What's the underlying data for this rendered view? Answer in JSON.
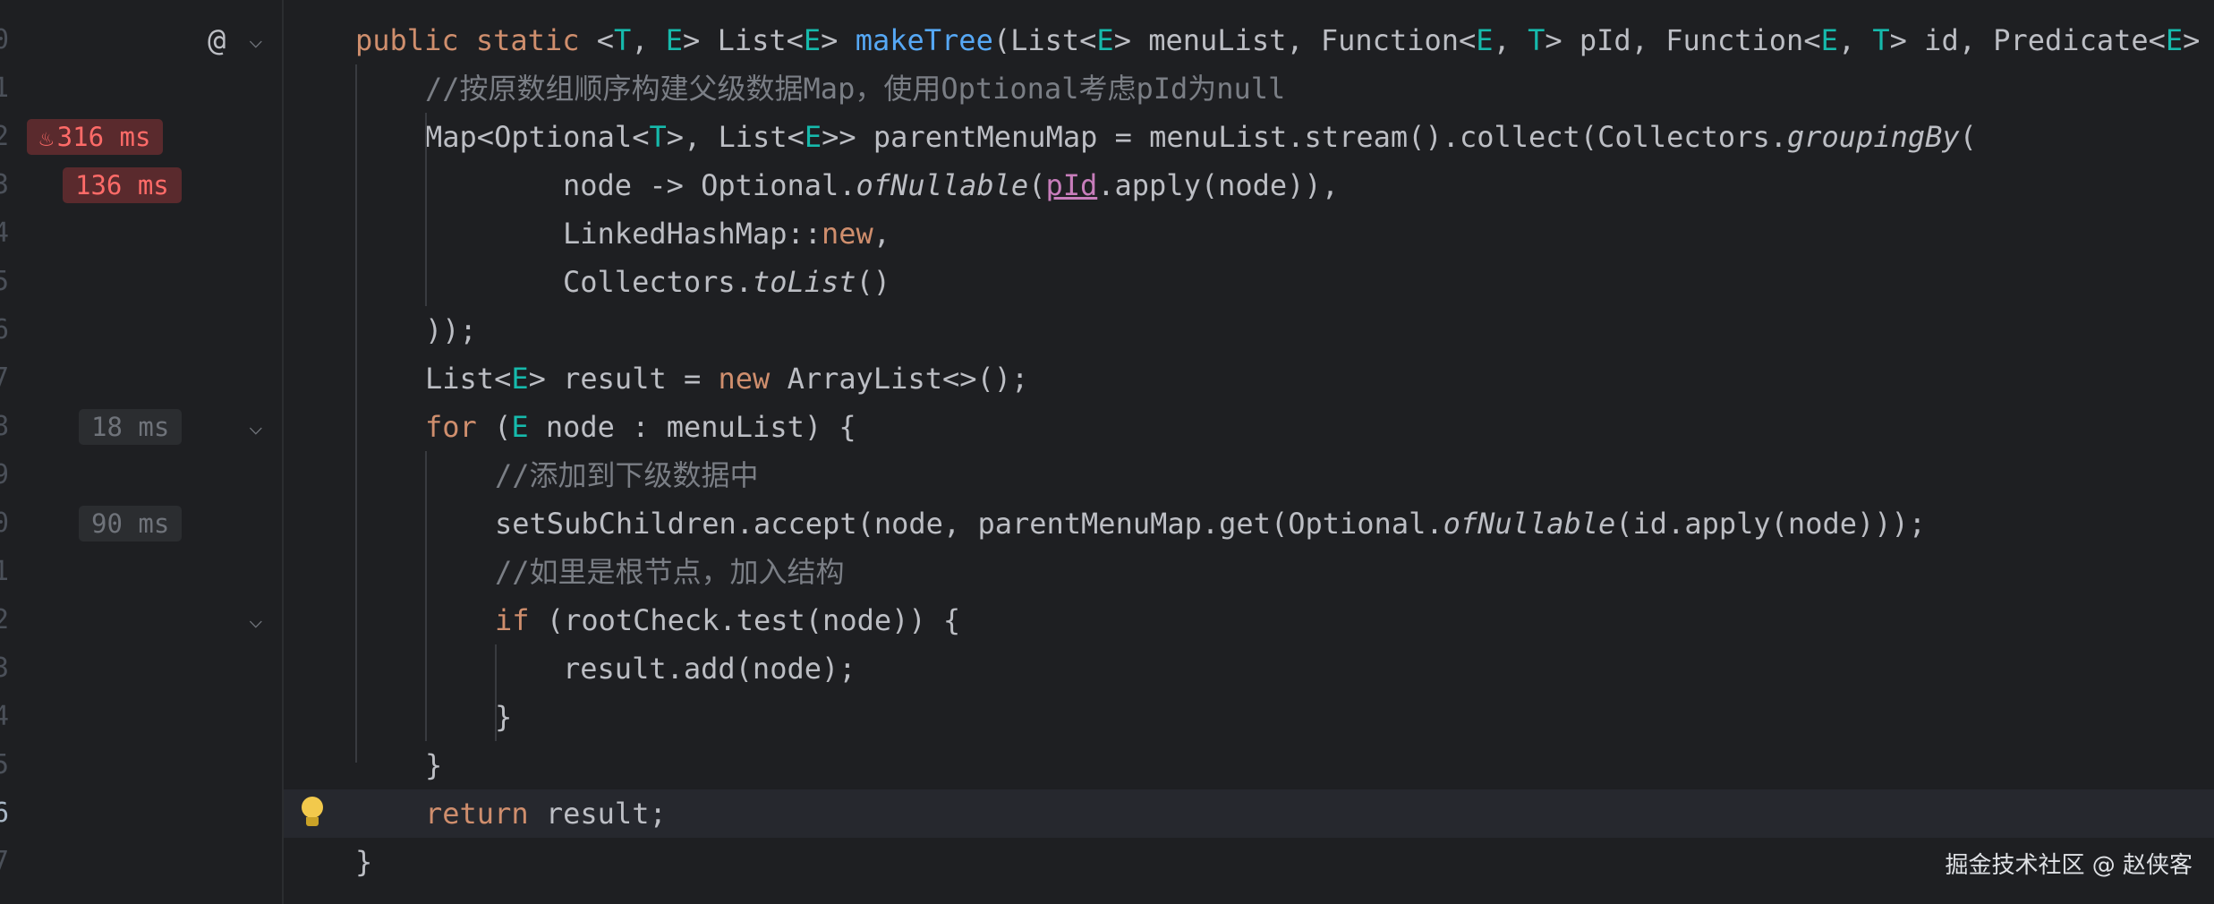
{
  "gutter": {
    "line_numbers": [
      "0",
      "1",
      "2",
      "3",
      "4",
      "5",
      "6",
      "7",
      "8",
      "9",
      "0",
      "1",
      "2",
      "3",
      "4",
      "5",
      "6",
      "7"
    ],
    "active_line": "6",
    "perf_badges": [
      {
        "label": "316 ms",
        "hot": true
      },
      {
        "label": "136 ms",
        "hot": true
      },
      {
        "label": "18 ms",
        "hot": false
      },
      {
        "label": "90 ms",
        "hot": false
      }
    ]
  },
  "code": {
    "l1": {
      "a": "public static ",
      "b": "<",
      "c": "T",
      "d": ", ",
      "e": "E",
      "f": "> List<",
      "g": "E",
      "h": "> ",
      "i": "makeTree",
      "j": "(List<",
      "k": "E",
      "l": "> menuList, Function<",
      "m": "E",
      "n": ", ",
      "o": "T",
      "p": "> pId, Function<",
      "q": "E",
      "r": ", ",
      "s": "T",
      "t": "> id, Predicate<",
      "u": "E",
      "v": "> r"
    },
    "l2": "//按原数组顺序构建父级数据Map，使用Optional考虑pId为null",
    "l3": {
      "a": "Map<Optional<",
      "b": "T",
      "c": ">, List<",
      "d": "E",
      "e": ">> parentMenuMap = menuList.stream().collect(Collectors.",
      "f": "groupingBy",
      "g": "("
    },
    "l4": {
      "a": "node -> Optional.",
      "b": "ofNullable",
      "c": "(",
      "d": "pId",
      "e": ".apply(node)),"
    },
    "l5": {
      "a": "LinkedHashMap::",
      "b": "new",
      "c": ","
    },
    "l6": {
      "a": "Collectors.",
      "b": "toList",
      "c": "()"
    },
    "l7": "));",
    "l8": {
      "a": "List<",
      "b": "E",
      "c": "> result = ",
      "d": "new",
      "e": " ArrayList<>();"
    },
    "l9": {
      "a": "for",
      "b": " (",
      "c": "E",
      "d": " node : menuList) {"
    },
    "l10": "//添加到下级数据中",
    "l11": {
      "a": "setSubChildren.accept(node, parentMenuMap.get(Optional.",
      "b": "ofNullable",
      "c": "(id.apply(node)));"
    },
    "l12": "//如里是根节点，加入结构",
    "l13": {
      "a": "if",
      "b": " (rootCheck.test(node)) {"
    },
    "l14": "result.add(node);",
    "l15": "}",
    "l16": "}",
    "l17": {
      "a": "return",
      "b": " result;"
    },
    "l18": "}"
  },
  "icons": {
    "at": "@",
    "chevron": "⌵",
    "flame": "♨"
  },
  "watermark": "掘金技术社区 @ 赵侠客",
  "colors": {
    "keyword": "#cf8e6d",
    "function": "#56a8f5",
    "type_param": "#16baac",
    "comment": "#7a7e85",
    "hot_badge": "#ff6b68"
  }
}
